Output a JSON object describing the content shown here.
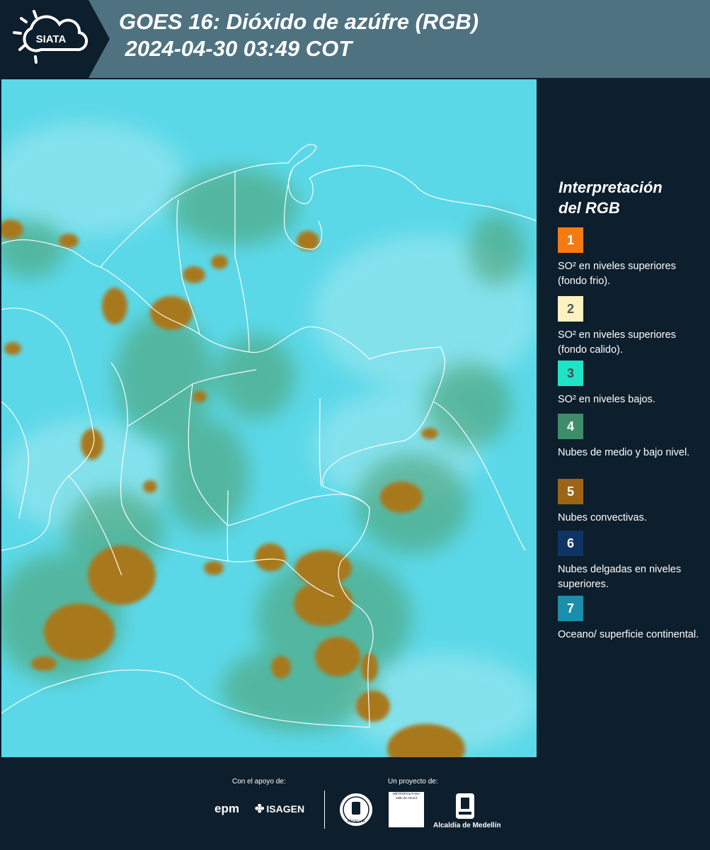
{
  "header": {
    "brand": "SIATA",
    "title": "GOES 16: Dióxido de azúfre (RGB)\n 2024-04-30 03:49 COT"
  },
  "legend": {
    "title_line1": "Interpretación",
    "title_line2": "del RGB",
    "items": [
      {
        "num": "1",
        "color": "#f47b14",
        "num_color": "#ffffff",
        "text": "SO² en niveles superiores (fondo frio)."
      },
      {
        "num": "2",
        "color": "#fbf2c0",
        "num_color": "#555555",
        "text": "SO² en niveles superiores (fondo calido)."
      },
      {
        "num": "3",
        "color": "#1fe3c7",
        "num_color": "#4a4a4a",
        "text": "SO² en niveles bajos."
      },
      {
        "num": "4",
        "color": "#3f8c6a",
        "num_color": "#ffffff",
        "text": "Nubes de medio y bajo nivel."
      },
      {
        "num": "5",
        "color": "#9c6414",
        "num_color": "#ffffff",
        "text": "Nubes convectivas."
      },
      {
        "num": "6",
        "color": "#0e3464",
        "num_color": "#ffffff",
        "text": "Nubes delgadas en niveles superiores."
      },
      {
        "num": "7",
        "color": "#1a8eaa",
        "num_color": "#ffffff",
        "text": "Oceano/ superficie continental."
      }
    ]
  },
  "footer": {
    "support_label": "Con el apoyo de:",
    "project_label": "Un proyecto de:",
    "sponsor1": "epm",
    "sponsor2": "ISAGEN",
    "partner1_text": "MEDELLÍN",
    "partner2_text": "Área",
    "partner2_sub": "METROPOLITANA\nValle de Aburrá",
    "partner3": "Alcaldía de Medellín"
  },
  "colors": {
    "header_bg": "#4f7280",
    "logo_bg": "#0d1e2c",
    "panel_bg": "#0d1e2c",
    "map_base": "#57d6e6",
    "convective": "#a8781e",
    "midlevel": "#4fa572"
  }
}
